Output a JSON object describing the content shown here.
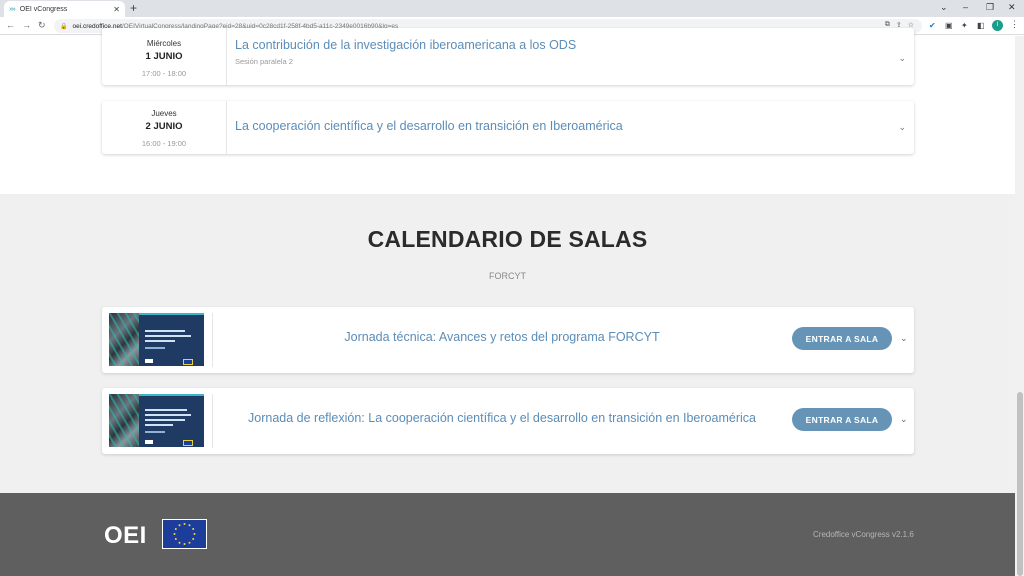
{
  "browser": {
    "tab_title": "OEI vCongress",
    "tab_favicon": "»»",
    "new_tab": "+",
    "url_host": "oei.credoffice.net",
    "url_rest": "/OEIVirtualCongress/landingPage?eid=28&uid=0c28cd1f-258f-4bd5-a11c-2349e0016b90&lg=es",
    "profile_initial": "I"
  },
  "sessions": [
    {
      "day": "Miércoles",
      "date": "1 JUNIO",
      "time": "17:00 - 18:00",
      "title": "La contribución de la investigación iberoamericana a los ODS",
      "subtitle": "Sesión paralela 2"
    },
    {
      "day": "Jueves",
      "date": "2 JUNIO",
      "time": "16:00 - 19:00",
      "title": "La cooperación científica y el desarrollo en transición en Iberoamérica"
    }
  ],
  "calendar": {
    "title": "CALENDARIO DE SALAS",
    "subtitle": "FORCYT",
    "rooms": [
      {
        "title": "Jornada técnica: Avances y retos del programa FORCYT",
        "button": "ENTRAR A SALA"
      },
      {
        "title": "Jornada de reflexión: La cooperación científica y el desarrollo en transición en Iberoamérica",
        "button": "ENTRAR A SALA"
      }
    ]
  },
  "footer": {
    "logo": "OEI",
    "version": "Credoffice vCongress v2.1.6"
  },
  "colors": {
    "link_blue": "#5b8db8",
    "button_blue": "#6694b7",
    "section_bg": "#f0f0f0",
    "footer_bg": "#5f5f5f"
  }
}
